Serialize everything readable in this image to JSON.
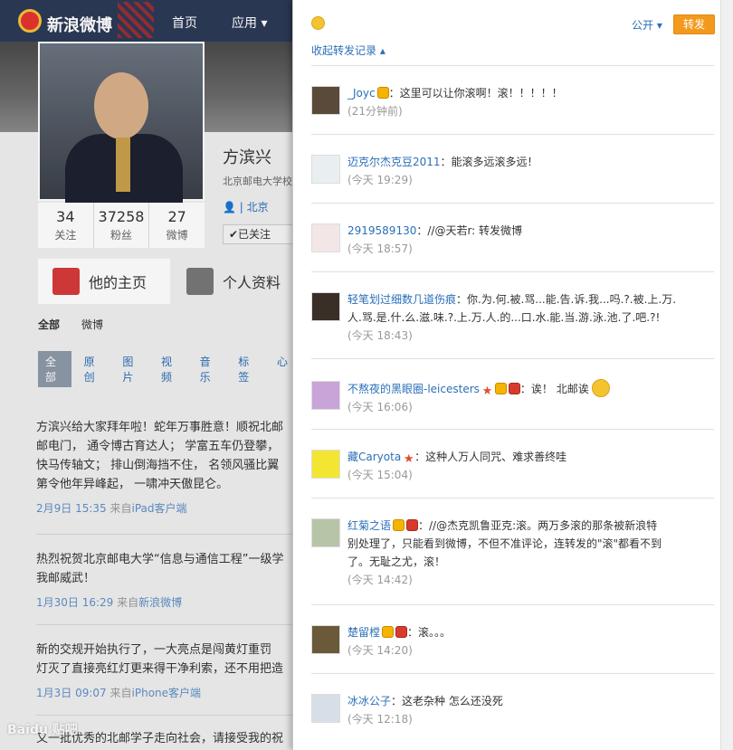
{
  "topbar": {
    "logo_text": "新浪微博",
    "nav": [
      "首页",
      "应用 ▾"
    ]
  },
  "profile": {
    "name": "方滨兴",
    "desc": "北京邮电大学校",
    "location": "北京",
    "followed": "✔已关注",
    "stats": [
      {
        "num": "34",
        "label": "关注"
      },
      {
        "num": "37258",
        "label": "粉丝"
      },
      {
        "num": "27",
        "label": "微博"
      }
    ],
    "tabs": [
      "他的主页",
      "个人资料"
    ],
    "filter_main": [
      "全部",
      "微博"
    ],
    "filter_sub": [
      "全部",
      "原创",
      "图片",
      "视频",
      "音乐",
      "标签",
      "心"
    ]
  },
  "posts": [
    {
      "lines": [
        "方滨兴给大家拜年啦！蛇年万事胜意！顺祝北邮",
        "邮电门， 通令博古育达人； 学富五车仍登攀，",
        "快马传轴文； 排山倒海挡不住， 名领风骚比翼",
        "第令他年异峰起， 一啸冲天傲昆仑。"
      ],
      "date": "2月9日 15:35",
      "from": "来自",
      "client": "iPad客户端"
    },
    {
      "lines": [
        "热烈祝贺北京邮电大学“信息与通信工程”一级学",
        "我邮威武！"
      ],
      "date": "1月30日 16:29",
      "from": "来自",
      "client": "新浪微博"
    },
    {
      "lines": [
        "新的交规开始执行了，一大亮点是闯黄灯重罚",
        "灯灭了直接亮红灯更来得干净利索，还不用把造"
      ],
      "date": "1月3日 09:07",
      "from": "来自",
      "client": "iPhone客户端"
    },
    {
      "lines": [
        "又一批优秀的北邮学子走向社会，请接受我的祝"
      ],
      "date": "",
      "from": "",
      "client": ""
    }
  ],
  "watermark": "Baidu 贴吧",
  "panel": {
    "visibility": "公开 ▾",
    "repost_button": "转发",
    "collapse": "收起转发记录 ▴",
    "items": [
      {
        "user": "_Joyc",
        "text": "：这里可以让你滚啊！滚！！！！！",
        "time": "(21分钟前)",
        "avatar_color": "#5a4a3a"
      },
      {
        "user": "迈克尔杰克豆2011",
        "text": "：能滚多远滚多远！",
        "time": "(今天 19:29)",
        "avatar_color": "#e9eef0"
      },
      {
        "user": "2919589130",
        "text": "：//@天若r: 转发微博",
        "time": "(今天 18:57)",
        "avatar_color": "#f2e6e6"
      },
      {
        "user": "轻笔划过细数几道伤痕",
        "text": "：你.为.何.被.骂...能.告.诉.我...吗.?.被.上.万.",
        "text2": "人.骂.是.什.么.滋.味.?.上.万.人.的...口.水.能.当.游.泳.池.了.吧.?!",
        "time": "(今天 18:43)",
        "avatar_color": "#3a2f28"
      },
      {
        "user": "不熬夜的黑眼圈-leicesters",
        "text": "：诶！ 北邮诶",
        "time": "(今天 16:06)",
        "avatar_color": "#c8a4d8"
      },
      {
        "user": "藏Caryota",
        "text": "：这种人万人同咒、难求善终哇",
        "time": "(今天 15:04)",
        "avatar_color": "#f2e633"
      },
      {
        "user": "红菊之语",
        "text": "：//@杰克凯鲁亚克:滚。两万多滚的那条被新浪特",
        "text2": "别处理了，只能看到微博，不但不准评论，连转发的\"滚\"都看不到",
        "text3": "了。无耻之尤，滚！",
        "time": "(今天 14:42)",
        "avatar_color": "#b7c4a8"
      },
      {
        "user": "楚留樘",
        "text": "：滚。。。",
        "time": "(今天 14:20)",
        "avatar_color": "#6a5a3a"
      },
      {
        "user": "冰冰公子",
        "text": "：这老杂种 怎么还没死",
        "time": "(今天 12:18)",
        "avatar_color": "#d8dee8"
      }
    ]
  }
}
